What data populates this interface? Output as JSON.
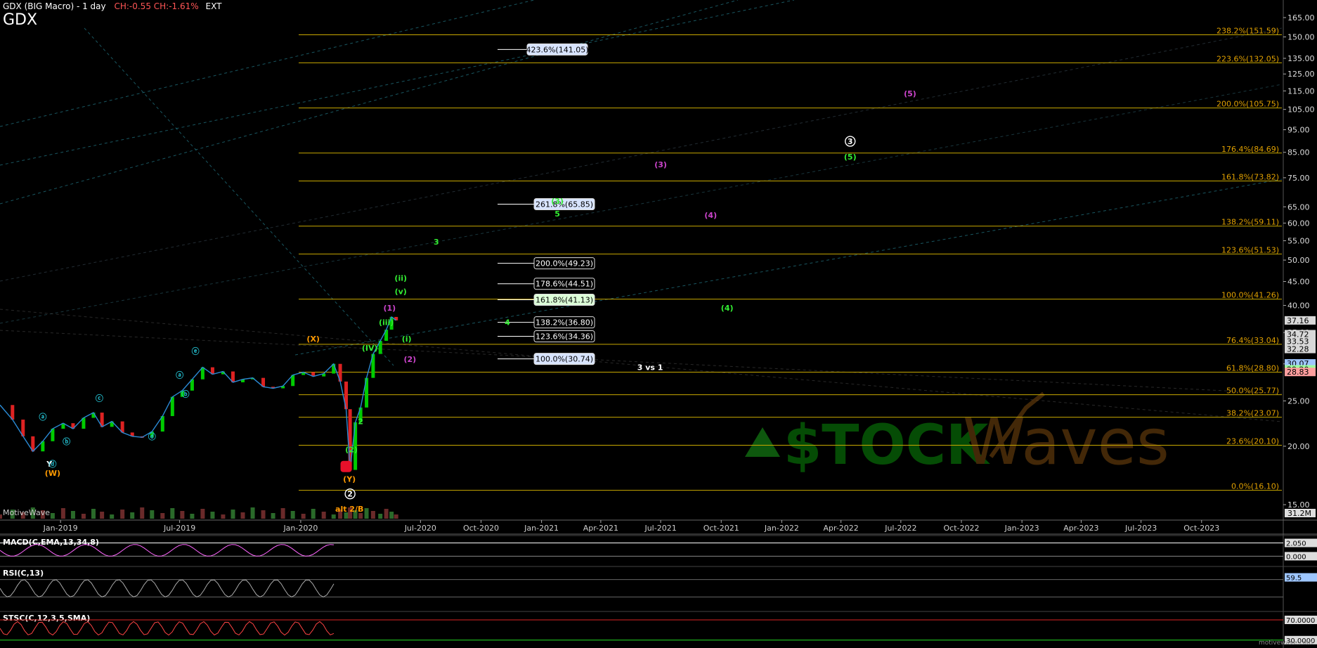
{
  "header": {
    "title": "GDX (BIG Macro) - 1 day",
    "change": "CH:-0.55  CH:-1.61%",
    "ext": "EXT",
    "ticker": "GDX"
  },
  "brand": "MotiveWave",
  "watermark": {
    "stock": "$TOCK",
    "waves": "Waves"
  },
  "footer_watermark": "motivewave.com",
  "colors": {
    "background": "#000000",
    "fib_line": "#c8a800",
    "fib_label": "#e0a000",
    "up_candle": "#00cc00",
    "down_candle": "#dd2222",
    "wave_green": "#33ee33",
    "wave_orange": "#ff9a00",
    "wave_magenta": "#cc44cc",
    "wave_cyan": "#22b8c8",
    "trend_cyan": "#2a8fa0"
  },
  "chart_data": {
    "type": "line",
    "title": "GDX (BIG Macro) - 1 day",
    "y_scale": "log",
    "ylim": [
      14,
      175
    ],
    "xlim": [
      "2018-10-01",
      "2024-01-31"
    ],
    "grid": false,
    "price_ticks": [
      165,
      150,
      135,
      125,
      115,
      105,
      95,
      85,
      75,
      65,
      60,
      55,
      50,
      45,
      40,
      35,
      30,
      25,
      20,
      15
    ],
    "x_ticks": [
      "Jan-2019",
      "Jul-2019",
      "Jan-2020",
      "Jul-2020",
      "Oct-2020",
      "Jan-2021",
      "Apr-2021",
      "Jul-2021",
      "Oct-2021",
      "Jan-2022",
      "Apr-2022",
      "Jul-2022",
      "Oct-2022",
      "Jan-2023",
      "Apr-2023",
      "Jul-2023",
      "Oct-2023"
    ],
    "x_tick_dates": [
      "2019-01-01",
      "2019-07-01",
      "2020-01-01",
      "2020-07-01",
      "2020-10-01",
      "2021-01-01",
      "2021-04-01",
      "2021-07-01",
      "2021-10-01",
      "2022-01-01",
      "2022-04-01",
      "2022-07-01",
      "2022-10-01",
      "2023-01-01",
      "2023-04-01",
      "2023-07-01",
      "2023-10-01"
    ],
    "price_series": {
      "dates": [
        "2018-10-01",
        "2018-10-20",
        "2018-11-05",
        "2018-11-20",
        "2018-12-05",
        "2018-12-20",
        "2019-01-05",
        "2019-01-20",
        "2019-02-05",
        "2019-02-20",
        "2019-03-05",
        "2019-03-20",
        "2019-04-05",
        "2019-04-20",
        "2019-05-05",
        "2019-05-20",
        "2019-06-05",
        "2019-06-20",
        "2019-07-05",
        "2019-07-20",
        "2019-08-05",
        "2019-08-20",
        "2019-09-05",
        "2019-09-20",
        "2019-10-05",
        "2019-10-20",
        "2019-11-05",
        "2019-11-20",
        "2019-12-05",
        "2019-12-20",
        "2020-01-05",
        "2020-01-20",
        "2020-02-05",
        "2020-02-20",
        "2020-03-01",
        "2020-03-10",
        "2020-03-16",
        "2020-03-24",
        "2020-04-01",
        "2020-04-10",
        "2020-04-20",
        "2020-05-01",
        "2020-05-10",
        "2020-05-18",
        "2020-05-25"
      ],
      "close": [
        24.5,
        22.8,
        21.0,
        19.5,
        20.5,
        21.8,
        22.4,
        21.8,
        23.0,
        23.6,
        22.0,
        22.6,
        21.4,
        21.0,
        20.9,
        21.5,
        23.2,
        25.5,
        26.3,
        27.8,
        29.5,
        28.5,
        28.9,
        27.4,
        27.8,
        28.0,
        26.8,
        26.6,
        26.9,
        28.4,
        28.8,
        28.2,
        28.6,
        30.0,
        27.5,
        24.0,
        17.8,
        22.5,
        24.2,
        28.0,
        31.5,
        33.6,
        35.5,
        37.8,
        37.16
      ]
    },
    "current_price": 37.16,
    "price_labels": [
      37.16,
      34.72,
      33.53,
      32.28,
      30.07,
      29.2,
      28.83
    ],
    "volume_label": "31.2M",
    "fib_levels": [
      {
        "label": "238.2%(151.59)",
        "value": 151.59
      },
      {
        "label": "223.6%(132.05)",
        "value": 132.05
      },
      {
        "label": "200.0%(105.75)",
        "value": 105.75
      },
      {
        "label": "176.4%(84.69)",
        "value": 84.69
      },
      {
        "label": "161.8%(73.82)",
        "value": 73.82
      },
      {
        "label": "138.2%(59.11)",
        "value": 59.11
      },
      {
        "label": "123.6%(51.53)",
        "value": 51.53
      },
      {
        "label": "100.0%(41.26)",
        "value": 41.26
      },
      {
        "label": "76.4%(33.04)",
        "value": 33.04
      },
      {
        "label": "61.8%(28.80)",
        "value": 28.8
      },
      {
        "label": "50.0%(25.77)",
        "value": 25.77
      },
      {
        "label": "38.2%(23.07)",
        "value": 23.07
      },
      {
        "label": "23.6%(20.10)",
        "value": 20.1
      },
      {
        "label": "0.0%(16.10)",
        "value": 16.1
      }
    ],
    "target_boxes": [
      {
        "label": "423.6%(141.05)",
        "value": 141.05,
        "style": "blue"
      },
      {
        "label": "261.8%(65.85)",
        "value": 65.85,
        "style": "blue"
      },
      {
        "label": "200.0%(49.23)",
        "value": 49.23,
        "style": "white"
      },
      {
        "label": "178.6%(44.51)",
        "value": 44.51,
        "style": "white"
      },
      {
        "label": "161.8%(41.13)",
        "value": 41.13,
        "style": "green"
      },
      {
        "label": "138.2%(36.80)",
        "value": 36.8,
        "style": "white"
      },
      {
        "label": "123.6%(34.36)",
        "value": 34.36,
        "style": "white"
      },
      {
        "label": "100.0%(30.74)",
        "value": 30.74,
        "style": "blue"
      }
    ],
    "wave_labels": [
      {
        "text": "3",
        "date": "2022-04-15",
        "value": 88.5,
        "color": "white",
        "circled": true
      },
      {
        "text": "(5)",
        "date": "2022-04-15",
        "value": 82.0,
        "color": "green"
      },
      {
        "text": "(5)",
        "date": "2022-07-15",
        "value": 112.0,
        "color": "magenta"
      },
      {
        "text": "(3)",
        "date": "2021-07-01",
        "value": 79.0,
        "color": "magenta"
      },
      {
        "text": "(4)",
        "date": "2021-09-15",
        "value": 61.5,
        "color": "magenta"
      },
      {
        "text": "(3)",
        "date": "2021-01-25",
        "value": 66.0,
        "color": "green"
      },
      {
        "text": "5",
        "date": "2021-01-25",
        "value": 62.0,
        "color": "green"
      },
      {
        "text": "3",
        "date": "2020-07-25",
        "value": 54.0,
        "color": "green"
      },
      {
        "text": "(4)",
        "date": "2021-10-10",
        "value": 39.0,
        "color": "green"
      },
      {
        "text": "4",
        "date": "2020-11-10",
        "value": 36.3,
        "color": "green"
      },
      {
        "text": "3 vs 1",
        "date": "2021-06-15",
        "value": 29.1,
        "color": "white"
      },
      {
        "text": "(1)",
        "date": "2020-05-15",
        "value": 39.0,
        "color": "magenta"
      },
      {
        "text": "(2)",
        "date": "2020-06-15",
        "value": 30.3,
        "color": "magenta"
      },
      {
        "text": "(iii)",
        "date": "2020-05-10",
        "value": 36.3,
        "color": "green"
      },
      {
        "text": "(ii)",
        "date": "2020-06-01",
        "value": 45.2,
        "color": "green"
      },
      {
        "text": "(v)",
        "date": "2020-06-01",
        "value": 42.3,
        "color": "green"
      },
      {
        "text": "(i)",
        "date": "2020-06-10",
        "value": 33.5,
        "color": "green"
      },
      {
        "text": "(X)",
        "date": "2020-01-20",
        "value": 33.5,
        "color": "orange"
      },
      {
        "text": "(Y)",
        "date": "2020-03-15",
        "value": 16.8,
        "color": "orange"
      },
      {
        "text": "(W)",
        "date": "2018-12-20",
        "value": 17.3,
        "color": "orange"
      },
      {
        "text": "Y",
        "date": "2018-12-15",
        "value": 18.1,
        "color": "white"
      },
      {
        "text": "2",
        "date": "2020-03-16",
        "value": 15.6,
        "color": "white",
        "circled": true
      },
      {
        "text": "(2)",
        "date": "2020-03-18",
        "value": 19.4,
        "color": "green"
      },
      {
        "text": "2",
        "date": "2020-04-01",
        "value": 22.3,
        "color": "green"
      },
      {
        "text": "alt 2/B",
        "date": "2020-03-15",
        "value": 14.5,
        "color": "orange"
      },
      {
        "text": "(IV)",
        "date": "2020-04-15",
        "value": 32.0,
        "color": "green"
      },
      {
        "text": "ⓔ",
        "date": "2019-07-25",
        "value": 31.5,
        "color": "cyan"
      },
      {
        "text": "ⓒ",
        "date": "2019-03-01",
        "value": 25.0,
        "color": "cyan"
      },
      {
        "text": "ⓓ",
        "date": "2019-05-20",
        "value": 20.7,
        "color": "cyan"
      },
      {
        "text": "ⓐ",
        "date": "2018-12-05",
        "value": 22.8,
        "color": "cyan"
      },
      {
        "text": "ⓑ",
        "date": "2019-01-10",
        "value": 20.2,
        "color": "cyan"
      },
      {
        "text": "ⓓ",
        "date": "2018-12-20",
        "value": 18.1,
        "color": "cyan"
      },
      {
        "text": "ⓐ",
        "date": "2019-07-01",
        "value": 28.0,
        "color": "cyan"
      },
      {
        "text": "ⓑ",
        "date": "2019-07-10",
        "value": 25.5,
        "color": "cyan"
      }
    ],
    "indicators": [
      {
        "name": "MACD(C,EMA,13,34,8)",
        "values": [
          2.05,
          0.0
        ],
        "labels": [
          "2.050",
          "0.000"
        ]
      },
      {
        "name": "RSI(C,13)",
        "values": [
          59.5
        ],
        "labels": [
          "59.5"
        ]
      },
      {
        "name": "STSC(C,12,3,5,SMA)",
        "values": [
          70.0,
          30.0
        ],
        "labels": [
          "70.0000",
          "30.0000"
        ]
      }
    ]
  }
}
